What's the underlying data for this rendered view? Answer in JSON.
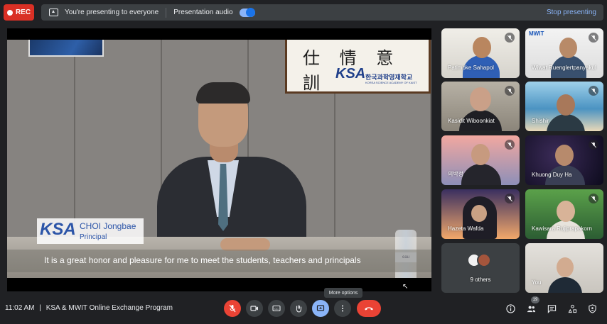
{
  "recording": {
    "label": "REC"
  },
  "presenting_bar": {
    "message": "You're presenting to everyone",
    "audio_label": "Presentation audio",
    "audio_on": true,
    "stop_label": "Stop presenting"
  },
  "presentation": {
    "frame_calligraphy": "仕 情 意 訓",
    "frame_logo": "KSA",
    "frame_school_name": "한국과학영재학교",
    "frame_school_sub": "KOREA SCIENCE ACADEMY OF KAIST",
    "lower_third_logo": "KSA",
    "speaker_name": "CHOI Jongbae",
    "speaker_title": "Principal",
    "subtitle": "It is a great honor and pleasure for me to meet the students, teachers and principals",
    "bottle_label": "eau"
  },
  "tooltip": "More options",
  "participants": [
    {
      "name": "Patimoke Sahapol",
      "muted": true
    },
    {
      "name": "Wiwat Ruenglertpanyakul",
      "muted": true,
      "logo": "MWIT"
    },
    {
      "name": "Kasidit Wiboonkiat",
      "muted": true
    },
    {
      "name": "Shishir",
      "muted": true
    },
    {
      "name": "의박정",
      "muted": true
    },
    {
      "name": "Khuong Duy Ha",
      "muted": true
    },
    {
      "name": "Hazeta Wafda",
      "muted": true
    },
    {
      "name": "Kawisara Rujiprapakorn",
      "muted": true
    },
    {
      "name": "9 others",
      "muted": false
    },
    {
      "name": "You",
      "muted": false
    }
  ],
  "footer": {
    "time": "11:02 AM",
    "separator": "|",
    "meeting_title": "KSA & MWIT Online Exchange Program",
    "people_count": "19"
  },
  "colors": {
    "accent": "#8ab4f8",
    "danger": "#ea4335",
    "surface": "#3c4043",
    "background": "#202124"
  }
}
